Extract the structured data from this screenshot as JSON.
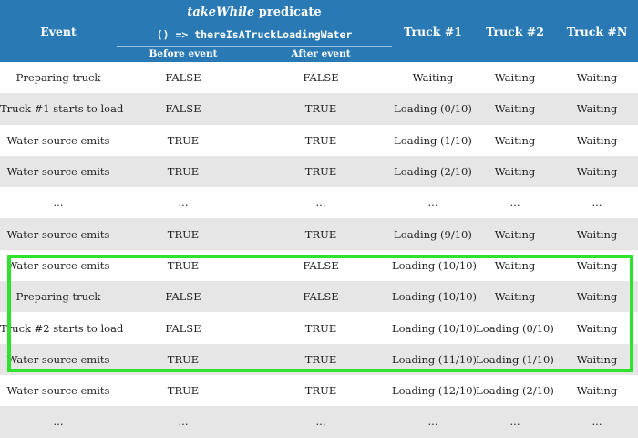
{
  "header": {
    "event": "Event",
    "predicate_name": "takeWhile",
    "predicate_suffix": " predicate",
    "predicate_code": "() => thereIsATruckLoadingWater",
    "before_event": "Before event",
    "after_event": "After event",
    "truck1": "Truck #1",
    "truck2": "Truck #2",
    "truckN": "Truck #N"
  },
  "rows": [
    {
      "event": "Preparing truck",
      "before": "FALSE",
      "after": "FALSE",
      "truck1": "Waiting",
      "truck2": "Waiting",
      "truckN": "Waiting"
    },
    {
      "event": "Truck #1 starts to load",
      "before": "FALSE",
      "after": "TRUE",
      "truck1": "Loading (0/10)",
      "truck2": "Waiting",
      "truckN": "Waiting"
    },
    {
      "event": "Water source emits",
      "before": "TRUE",
      "after": "TRUE",
      "truck1": "Loading (1/10)",
      "truck2": "Waiting",
      "truckN": "Waiting"
    },
    {
      "event": "Water source emits",
      "before": "TRUE",
      "after": "TRUE",
      "truck1": "Loading (2/10)",
      "truck2": "Waiting",
      "truckN": "Waiting"
    },
    {
      "event": "...",
      "before": "...",
      "after": "...",
      "truck1": "...",
      "truck2": "...",
      "truckN": "..."
    },
    {
      "event": "Water source emits",
      "before": "TRUE",
      "after": "TRUE",
      "truck1": "Loading (9/10)",
      "truck2": "Waiting",
      "truckN": "Waiting"
    },
    {
      "event": "Water source emits",
      "before": "TRUE",
      "after": "FALSE",
      "truck1": "Loading (10/10)",
      "truck2": "Waiting",
      "truckN": "Waiting"
    },
    {
      "event": "Preparing truck",
      "before": "FALSE",
      "after": "FALSE",
      "truck1": "Loading (10/10)",
      "truck2": "Waiting",
      "truckN": "Waiting"
    },
    {
      "event": "Truck #2 starts to load",
      "before": "FALSE",
      "after": "TRUE",
      "truck1": "Loading (10/10)",
      "truck2": "Loading (0/10)",
      "truckN": "Waiting"
    },
    {
      "event": "Water source emits",
      "before": "TRUE",
      "after": "TRUE",
      "truck1": "Loading (11/10)",
      "truck2": "Loading (1/10)",
      "truckN": "Waiting"
    },
    {
      "event": "Water source emits",
      "before": "TRUE",
      "after": "TRUE",
      "truck1": "Loading (12/10)",
      "truck2": "Loading (2/10)",
      "truckN": "Waiting"
    },
    {
      "event": "...",
      "before": "...",
      "after": "...",
      "truck1": "...",
      "truck2": "...",
      "truckN": "..."
    }
  ],
  "colors": {
    "header_bg": "#2979b4",
    "stripe": "#e6e6e6",
    "highlight_border": "#2ee22e"
  }
}
